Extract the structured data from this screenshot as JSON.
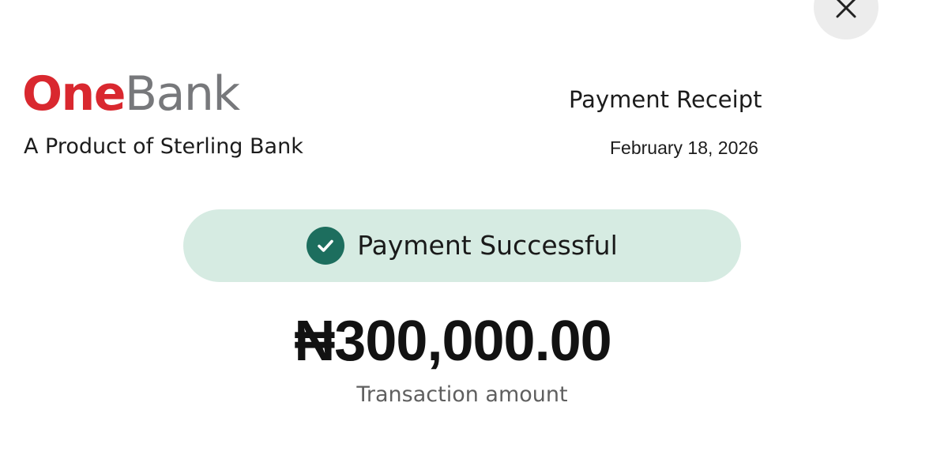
{
  "header": {
    "close_icon": "close-icon",
    "logo": {
      "part1": "One",
      "part2": "Bank",
      "part1_color": "#d9282f",
      "part2_color": "#77787b"
    },
    "tagline": "A Product of Sterling Bank",
    "receipt_title": "Payment Receipt",
    "receipt_date": "February 18, 2026"
  },
  "status": {
    "icon": "check-circle-icon",
    "text": "Payment Successful",
    "pill_color": "#d6ebe2",
    "icon_color": "#1d6e5e"
  },
  "transaction": {
    "amount": "₦300,000.00",
    "label": "Transaction amount"
  }
}
